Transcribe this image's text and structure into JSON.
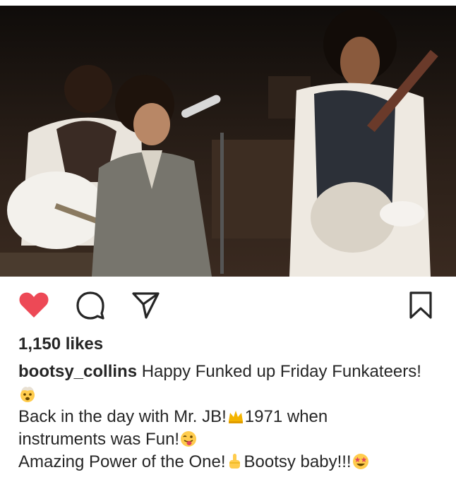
{
  "post": {
    "likes_text": "1,150 likes",
    "username": "bootsy_collins",
    "caption_line1": "Happy Funked up Friday Funkateers!",
    "caption_line2a": "Back in the day with Mr. JB!",
    "caption_line2b": "1971 when",
    "caption_line3": "instruments was Fun!",
    "caption_line4a": "Amazing Power of the One!",
    "caption_line4b": "Bootsy baby!!!"
  },
  "colors": {
    "like_red": "#ed4956",
    "text": "#262626",
    "icon": "#262626"
  },
  "icons": {
    "like": "heart-icon",
    "comment": "comment-bubble-icon",
    "share": "paper-plane-icon",
    "save": "bookmark-icon"
  }
}
